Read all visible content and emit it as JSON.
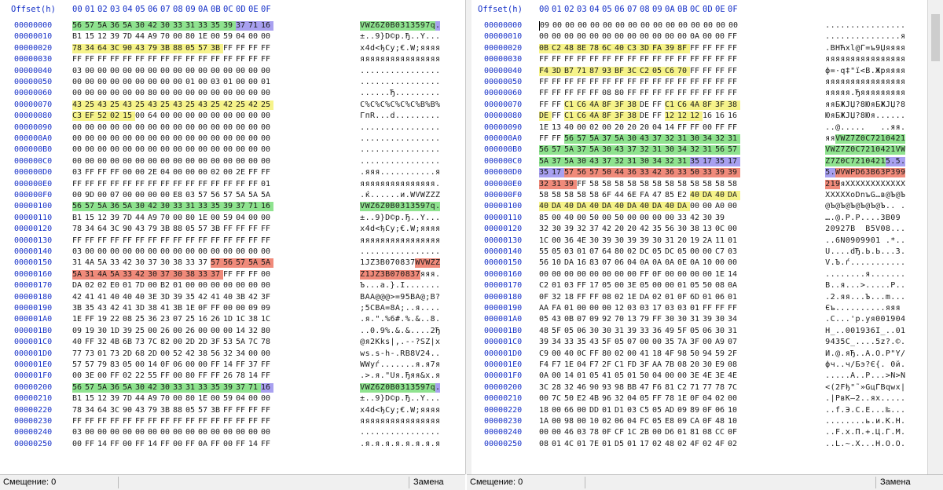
{
  "header": {
    "offset_label": "Offset(h)",
    "columns": [
      "00",
      "01",
      "02",
      "03",
      "04",
      "05",
      "06",
      "07",
      "08",
      "09",
      "0A",
      "0B",
      "0C",
      "0D",
      "0E",
      "0F"
    ]
  },
  "left": {
    "status": {
      "offset": "Смещение: 0",
      "mode": "Замена"
    },
    "rows": [
      {
        "addr": "00000000",
        "bytes": "56 57 5A 36 5A 30 42 30 33 31 33 35 39 37 71 16",
        "hl": "gggggggggggggppp",
        "ascii": "VWZ6Z0B0313597q.",
        "ahl": "gggggggggggggggp"
      },
      {
        "addr": "00000010",
        "bytes": "B1 15 12 39 7D 44 A9 70 00 80 1E 00 59 04 00 00",
        "hl": "",
        "ascii": "±..9}D©p.Ђ..Y...",
        "ahl": ""
      },
      {
        "addr": "00000020",
        "bytes": "78 34 64 3C 90 43 79 3B 88 05 57 3B FF FF FF FF",
        "hl": "yyyyyyyyyyyy",
        "ascii": "x4d<ђCy;€.W;яяяя",
        "ahl": ""
      },
      {
        "addr": "00000030",
        "bytes": "FF FF FF FF FF FF FF FF FF FF FF FF FF FF FF FF",
        "hl": "",
        "ascii": "яяяяяяяяяяяяяяяя",
        "ahl": ""
      },
      {
        "addr": "00000040",
        "bytes": "03 00 00 00 00 00 00 00 00 00 00 00 00 00 00 00",
        "hl": "",
        "ascii": "................",
        "ahl": ""
      },
      {
        "addr": "00000050",
        "bytes": "00 00 00 00 00 00 00 00 00 01 00 03 01 00 00 01",
        "hl": "",
        "ascii": "................",
        "ahl": ""
      },
      {
        "addr": "00000060",
        "bytes": "00 00 00 00 00 00 80 00 00 00 00 00 00 00 00 00",
        "hl": "",
        "ascii": "......Ђ.........",
        "ahl": ""
      },
      {
        "addr": "00000070",
        "bytes": "43 25 43 25 43 25 43 25 43 25 43 25 42 25 42 25",
        "hl": "yyyyyyyyyyyyyyyy",
        "ascii": "C%C%C%C%C%C%B%B%",
        "ahl": ""
      },
      {
        "addr": "00000080",
        "bytes": "C3 EF 52 02 15 00 64 00 00 00 00 00 00 00 00 00",
        "hl": "yyyyy",
        "ascii": "ГпR...d.........",
        "ahl": ""
      },
      {
        "addr": "00000090",
        "bytes": "00 00 00 00 00 00 00 00 00 00 00 00 00 00 00 00",
        "hl": "",
        "ascii": "................",
        "ahl": ""
      },
      {
        "addr": "000000A0",
        "bytes": "00 00 00 00 00 00 00 00 00 00 00 00 00 00 00 00",
        "hl": "",
        "ascii": "................",
        "ahl": ""
      },
      {
        "addr": "000000B0",
        "bytes": "00 00 00 00 00 00 00 00 00 00 00 00 00 00 00 00",
        "hl": "",
        "ascii": "................",
        "ahl": ""
      },
      {
        "addr": "000000C0",
        "bytes": "00 00 00 00 00 00 00 00 00 00 00 00 00 00 00 00",
        "hl": "",
        "ascii": "................",
        "ahl": ""
      },
      {
        "addr": "000000D0",
        "bytes": "03 FF FF FF 00 00 2E 04 00 00 00 02 00 2E FF FF",
        "hl": "",
        "ascii": ".яяя...........яя",
        "ahl": ""
      },
      {
        "addr": "000000E0",
        "bytes": "FF FF FF FF FF FF FF FF FF FF FF FF FF FF FF 01",
        "hl": "",
        "ascii": "яяяяяяяяяяяяяяя.",
        "ahl": ""
      },
      {
        "addr": "000000F0",
        "bytes": "00 9D 00 07 00 00 00 00 E8 03 57 56 57 5A 5A 5A",
        "hl": "",
        "ascii": ".ќ......и.WVWZZZ",
        "ahl": ""
      },
      {
        "addr": "00000100",
        "bytes": "56 57 5A 36 5A 30 42 30 33 31 33 35 39 37 71 16",
        "hl": "gggggggggggggggg",
        "ascii": "VWZ6Z0B0313597q.",
        "ahl": "gggggggggggggggg"
      },
      {
        "addr": "00000110",
        "bytes": "B1 15 12 39 7D 44 A9 70 00 80 1E 00 59 04 00 00",
        "hl": "",
        "ascii": "±..9}D©p.Ђ..Y...",
        "ahl": ""
      },
      {
        "addr": "00000120",
        "bytes": "78 34 64 3C 90 43 79 3B 88 05 57 3B FF FF FF FF",
        "hl": "",
        "ascii": "x4d<ђCy;€.W;яяяя",
        "ahl": ""
      },
      {
        "addr": "00000130",
        "bytes": "FF FF FF FF FF FF FF FF FF FF FF FF FF FF FF FF",
        "hl": "",
        "ascii": "яяяяяяяяяяяяяяяя",
        "ahl": ""
      },
      {
        "addr": "00000140",
        "bytes": "03 00 00 00 00 00 00 00 00 00 00 00 00 00 00 00",
        "hl": "",
        "ascii": "................",
        "ahl": ""
      },
      {
        "addr": "00000150",
        "bytes": "31 4A 5A 33 42 30 37 30 38 33 37 57 56 57 5A 5A",
        "hl": "...........rrrrr",
        "ascii": "1JZ3B070837WVWZZ",
        "ahl": "...........rrrrr"
      },
      {
        "addr": "00000160",
        "bytes": "5A 31 4A 5A 33 42 30 37 30 38 33 37 FF FF FF 00",
        "hl": "rrrrrrrrrrrr",
        "ascii": "Z1JZ3B070837яяя.",
        "ahl": "rrrrrrrrrrrr"
      },
      {
        "addr": "00000170",
        "bytes": "DA 02 02 E0 01 7D 00 B2 01 00 00 00 00 00 00 00",
        "hl": "",
        "ascii": "Ъ...а.}.І.......",
        "ahl": ""
      },
      {
        "addr": "00000180",
        "bytes": "42 41 41 40 40 40 3E 3D 39 35 42 41 40 3B 42 3F",
        "hl": "",
        "ascii": "BAA@@@>=95BA@;B?",
        "ahl": ""
      },
      {
        "addr": "00000190",
        "bytes": "3B 35 43 42 41 3D 38 41 3B 1E 0F FF 00 00 09 09",
        "hl": "",
        "ascii": ";5CBA=8A;..я....",
        "ahl": ""
      },
      {
        "addr": "000001A0",
        "bytes": "1E FF 19 22 08 25 36 23 07 25 16 26 1D 1C 38 1C",
        "hl": "",
        "ascii": ".я.\".%6#.%.&..8.",
        "ahl": ""
      },
      {
        "addr": "000001B0",
        "bytes": "09 19 30 1D 39 25 00 26 00 26 00 00 00 14 32 80",
        "hl": "",
        "ascii": "..0.9%.&.&....2Ђ",
        "ahl": ""
      },
      {
        "addr": "000001C0",
        "bytes": "40 FF 32 4B 6B 73 7C 82 00 2D 2D 3F 53 5A 7C 78",
        "hl": "",
        "ascii": "@я2Kks|‚.--?SZ|x",
        "ahl": ""
      },
      {
        "addr": "000001D0",
        "bytes": "77 73 01 73 2D 68 2D 00 52 42 38 56 32 34 00 00",
        "hl": "",
        "ascii": "ws.s-h-.RB8V24..",
        "ahl": ""
      },
      {
        "addr": "000001E0",
        "bytes": "57 57 79 83 05 00 14 0F 06 00 00 FF 14 FF 37 FF",
        "hl": "",
        "ascii": "WWyѓ.......я.я7я",
        "ahl": ""
      },
      {
        "addr": "000001F0",
        "bytes": "00 3E 00 FF 02 22 55 FF 00 80 FF FF 26 78 14 FF",
        "hl": "",
        "ascii": ".>.я.\"Uя.Ђяя&x.я",
        "ahl": ""
      },
      {
        "addr": "00000200",
        "bytes": "56 57 5A 36 5A 30 42 30 33 31 33 35 39 37 71 16",
        "hl": "gggggggggggggggp",
        "ascii": "VWZ6Z0B0313597q.",
        "ahl": "gggggggggggggggp"
      },
      {
        "addr": "00000210",
        "bytes": "B1 15 12 39 7D 44 A9 70 00 80 1E 00 59 04 00 00",
        "hl": "",
        "ascii": "±..9}D©p.Ђ..Y...",
        "ahl": ""
      },
      {
        "addr": "00000220",
        "bytes": "78 34 64 3C 90 43 79 3B 88 05 57 3B FF FF FF FF",
        "hl": "",
        "ascii": "x4d<ђCy;€.W;яяяя",
        "ahl": ""
      },
      {
        "addr": "00000230",
        "bytes": "FF FF FF FF FF FF FF FF FF FF FF FF FF FF FF FF",
        "hl": "",
        "ascii": "яяяяяяяяяяяяяяяя",
        "ahl": ""
      },
      {
        "addr": "00000240",
        "bytes": "03 00 00 00 00 00 00 00 00 00 00 00 00 00 00 00",
        "hl": "",
        "ascii": "................",
        "ahl": ""
      },
      {
        "addr": "00000250",
        "bytes": "00 FF 14 FF 00 FF 14 FF 00 FF 0A FF 00 FF 14 FF",
        "hl": "",
        "ascii": ".я.я.я.я.я.я.я.я",
        "ahl": ""
      }
    ]
  },
  "right": {
    "status": {
      "offset": "Смещение: 0",
      "mode": "Замена"
    },
    "rows": [
      {
        "addr": "00000000",
        "bytes": "09 00 00 00 00 00 00 00 00 00 00 00 00 00 00 00",
        "hl": "",
        "ascii": "................",
        "ahl": ""
      },
      {
        "addr": "00000010",
        "bytes": "00 00 00 00 00 00 00 00 00 00 00 00 0A 00 00 FF",
        "hl": "",
        "ascii": "...............я",
        "ahl": ""
      },
      {
        "addr": "00000020",
        "bytes": "0B C2 48 8E 78 6C 40 C3 3D FA 39 8F FF FF FF FF",
        "hl": "yyyyyyyyyyyy",
        "ascii": ".BHЋxl@Г=ъ9Џяяяя",
        "ahl": ""
      },
      {
        "addr": "00000030",
        "bytes": "FF FF FF FF FF FF FF FF FF FF FF FF FF FF FF FF",
        "hl": "",
        "ascii": "яяяяяяяяяяяяяяяя",
        "ahl": ""
      },
      {
        "addr": "00000040",
        "bytes": "F4 3D B7 71 87 93 BF 3C C2 05 C6 70 FF FF FF FF",
        "hl": "yyyyyyyyyyyy",
        "ascii": "ф=·q‡\"ї<В.Жpяяяя",
        "ahl": ""
      },
      {
        "addr": "00000050",
        "bytes": "FF FF FF FF FF FF FF FF FF FF FF FF FF FF FF FF",
        "hl": "",
        "ascii": "яяяяяяяяяяяяяяяя",
        "ahl": ""
      },
      {
        "addr": "00000060",
        "bytes": "FF FF FF FF FF 08 80 FF FF FF FF FF FF FF FF FF",
        "hl": "",
        "ascii": "яяяяя.Ђяяяяяяяяя",
        "ahl": ""
      },
      {
        "addr": "00000070",
        "bytes": "FF FF C1 C6 4A 8F 3F 38 DE FF C1 C6 4A 8F 3F 38",
        "hl": "..yyyyyy..yyyyyy",
        "ascii": "яяБЖJЏ?8ЮяБЖJЏ?8",
        "ahl": ""
      },
      {
        "addr": "00000080",
        "bytes": "DE FF C1 C6 4A 8F 3F 38 DE FF 12 12 12 16 16 16",
        "hl": "y.yyyyyy..yyy",
        "ascii": "ЮяБЖJЏ?8Юя......",
        "ahl": ""
      },
      {
        "addr": "00000090",
        "bytes": "1E 13 40 00 02 00 20 20 20 04 14 FF FF 00 FF FF",
        "hl": "",
        "ascii": "..@.....   ..яя.яя",
        "ahl": ""
      },
      {
        "addr": "000000A0",
        "bytes": "FF FF 56 57 5A 37 5A 30 43 37 32 31 30 34 32 31",
        "hl": "..gggggggggggggg",
        "ascii": "яяVWZ7Z0C7210421",
        "ahl": "..gggggggggggggg"
      },
      {
        "addr": "000000B0",
        "bytes": "56 57 5A 37 5A 30 43 37 32 31 30 34 32 31 56 57",
        "hl": "gggggggggggggggg",
        "ascii": "VWZ7Z0C7210421VW",
        "ahl": "gggggggggggggggg"
      },
      {
        "addr": "000000C0",
        "bytes": "5A 37 5A 30 43 37 32 31 30 34 32 31 35 17 35 17",
        "hl": "ggggggggggggpppp",
        "ascii": "Z7Z0C72104215.5.",
        "ahl": "ggggggggggggpppp"
      },
      {
        "addr": "000000D0",
        "bytes": "35 17 57 56 57 50 44 36 33 42 36 33 50 33 39 39",
        "hl": "pprrrrrrrrrrrrrr",
        "ascii": "5.WVWPD63B63P399",
        "ahl": "pprrrrrrrrrrrrrr"
      },
      {
        "addr": "000000E0",
        "bytes": "32 31 39 FF 58 58 58 58 58 58 58 58 58 58 58 58",
        "hl": "rrr",
        "ascii": "219яXXXXXXXXXXXX",
        "ahl": "rrr"
      },
      {
        "addr": "000000F0",
        "bytes": "58 58 58 58 58 6F 44 6E FA 47 85 E2 40 DA 40 DA",
        "hl": "............yyyy",
        "ascii": "XXXXXoDnъG…в@Ъ@Ъ",
        "ahl": ""
      },
      {
        "addr": "00000100",
        "bytes": "40 DA 40 DA 40 DA 40 DA 40 DA 40 DA 00 00 A0 00",
        "hl": "yyyyyyyyyyyy",
        "ascii": "@Ъ@Ъ@Ъ@Ъ@Ъ@Ъ.. .",
        "ahl": ""
      },
      {
        "addr": "00000110",
        "bytes": "85 00 40 00 50 00 50 00 00 00 00 33 42 30 39",
        "hl": "",
        "ascii": "….@.P.P....3B09",
        "ahl": ""
      },
      {
        "addr": "00000120",
        "bytes": "32 30 39 32 37 42 20 20 42 35 56 30 38 13 0C 00",
        "hl": "",
        "ascii": "20927B  B5V08...",
        "ahl": ""
      },
      {
        "addr": "00000130",
        "bytes": "1C 00 36 4E 30 39 30 39 39 30 31 20 19 2A 11 01",
        "hl": "",
        "ascii": "..6N0909901 .*..",
        "ahl": ""
      },
      {
        "addr": "00000140",
        "bytes": "55 05 03 01 07 64 80 02 DC 05 DC 05 00 00 C7 03",
        "hl": "",
        "ascii": "U....dЂ.Ь.Ь...З.",
        "ahl": ""
      },
      {
        "addr": "00000150",
        "bytes": "56 10 DA 16 83 07 06 04 0A 0A 0A 0E 0A 10 00 00",
        "hl": "",
        "ascii": "V.Ъ.ѓ...........",
        "ahl": ""
      },
      {
        "addr": "00000160",
        "bytes": "00 00 00 00 00 00 00 00 FF 0F 00 00 00 00 1E 14",
        "hl": "",
        "ascii": "........я.......",
        "ahl": ""
      },
      {
        "addr": "00000170",
        "bytes": "C2 01 03 FF 17 05 00 3E 05 00 00 01 05 50 08 0A",
        "hl": "",
        "ascii": "В..я...>.....P..",
        "ahl": ""
      },
      {
        "addr": "00000180",
        "bytes": "0F 32 18 FF FF 08 02 1E DA 02 01 0F 6D 01 06 01",
        "hl": "",
        "ascii": ".2.яя...Ъ...m...",
        "ahl": ""
      },
      {
        "addr": "00000190",
        "bytes": "AA FA 01 00 00 00 12 03 03 17 03 03 01 FF FF FF",
        "hl": "",
        "ascii": "Єъ..........яяя",
        "ahl": ""
      },
      {
        "addr": "000001A0",
        "bytes": "05 43 0B 07 09 92 70 13 79 FF 30 30 31 39 30 34",
        "hl": "",
        "ascii": ".C...'p.yя001904",
        "ahl": ""
      },
      {
        "addr": "000001B0",
        "bytes": "48 5F 05 06 30 30 31 39 33 36 49 5F 05 06 30 31",
        "hl": "",
        "ascii": "H_..001936I_..01",
        "ahl": ""
      },
      {
        "addr": "000001C0",
        "bytes": "39 34 33 35 43 5F 05 07 00 00 35 7A 3F 00 A9 07",
        "hl": "",
        "ascii": "9435C_....5z?.©.",
        "ahl": ""
      },
      {
        "addr": "000001D0",
        "bytes": "C9 00 40 0C FF 80 02 00 41 18 4F 98 50 94 59 2F",
        "hl": "",
        "ascii": "Й.@.яЂ..A.O.P\"Y/",
        "ahl": ""
      },
      {
        "addr": "000001E0",
        "bytes": "F4 F7 1E 04 F7 2F C1 FD 3F AA 7B 08 20 30 E9 08",
        "hl": "",
        "ascii": "фч..ч/Бэ?Є{. 0й.",
        "ahl": ""
      },
      {
        "addr": "000001F0",
        "bytes": "0A 00 14 01 05 41 05 01 50 04 00 00 3E 4E 3E 4E",
        "hl": "",
        "ascii": ".....A..P...>N>N",
        "ahl": ""
      },
      {
        "addr": "00000200",
        "bytes": "3C 28 32 46 90 93 98 BB 47 F6 81 C2 71 77 78 7C",
        "hl": "",
        "ascii": "<(2Fђ\"˜»GцЃBqwx|",
        "ahl": ""
      },
      {
        "addr": "00000210",
        "bytes": "00 7C 50 E2 4B 96 32 04 05 FF 78 1E 0F 04 02 00",
        "hl": "",
        "ascii": ".|PвK–2..яx.....",
        "ahl": ""
      },
      {
        "addr": "00000220",
        "bytes": "18 00 66 00 DD 01 D1 03 C5 05 AD 09 89 0F 06 10",
        "hl": "",
        "ascii": "..f.Э.С.Е...‰...",
        "ahl": ""
      },
      {
        "addr": "00000230",
        "bytes": "1A 00 98 00 10 02 06 04 FC 05 E8 09 CA 0F 48 10",
        "hl": "",
        "ascii": "........ь.и.К.H.",
        "ahl": ""
      },
      {
        "addr": "00000240",
        "bytes": "00 00 46 03 78 0F CF 1C 2B 00 D6 01 81 08 CC 0F",
        "hl": "",
        "ascii": "..F.x.П.+.Ц.Ѓ.М.",
        "ahl": ""
      },
      {
        "addr": "00000250",
        "bytes": "08 01 4C 01 7E 01 D5 01 17 02 48 02 4F 02 4F 02",
        "hl": "",
        "ascii": "..L.~.Х...H.O.O.",
        "ahl": ""
      }
    ]
  }
}
